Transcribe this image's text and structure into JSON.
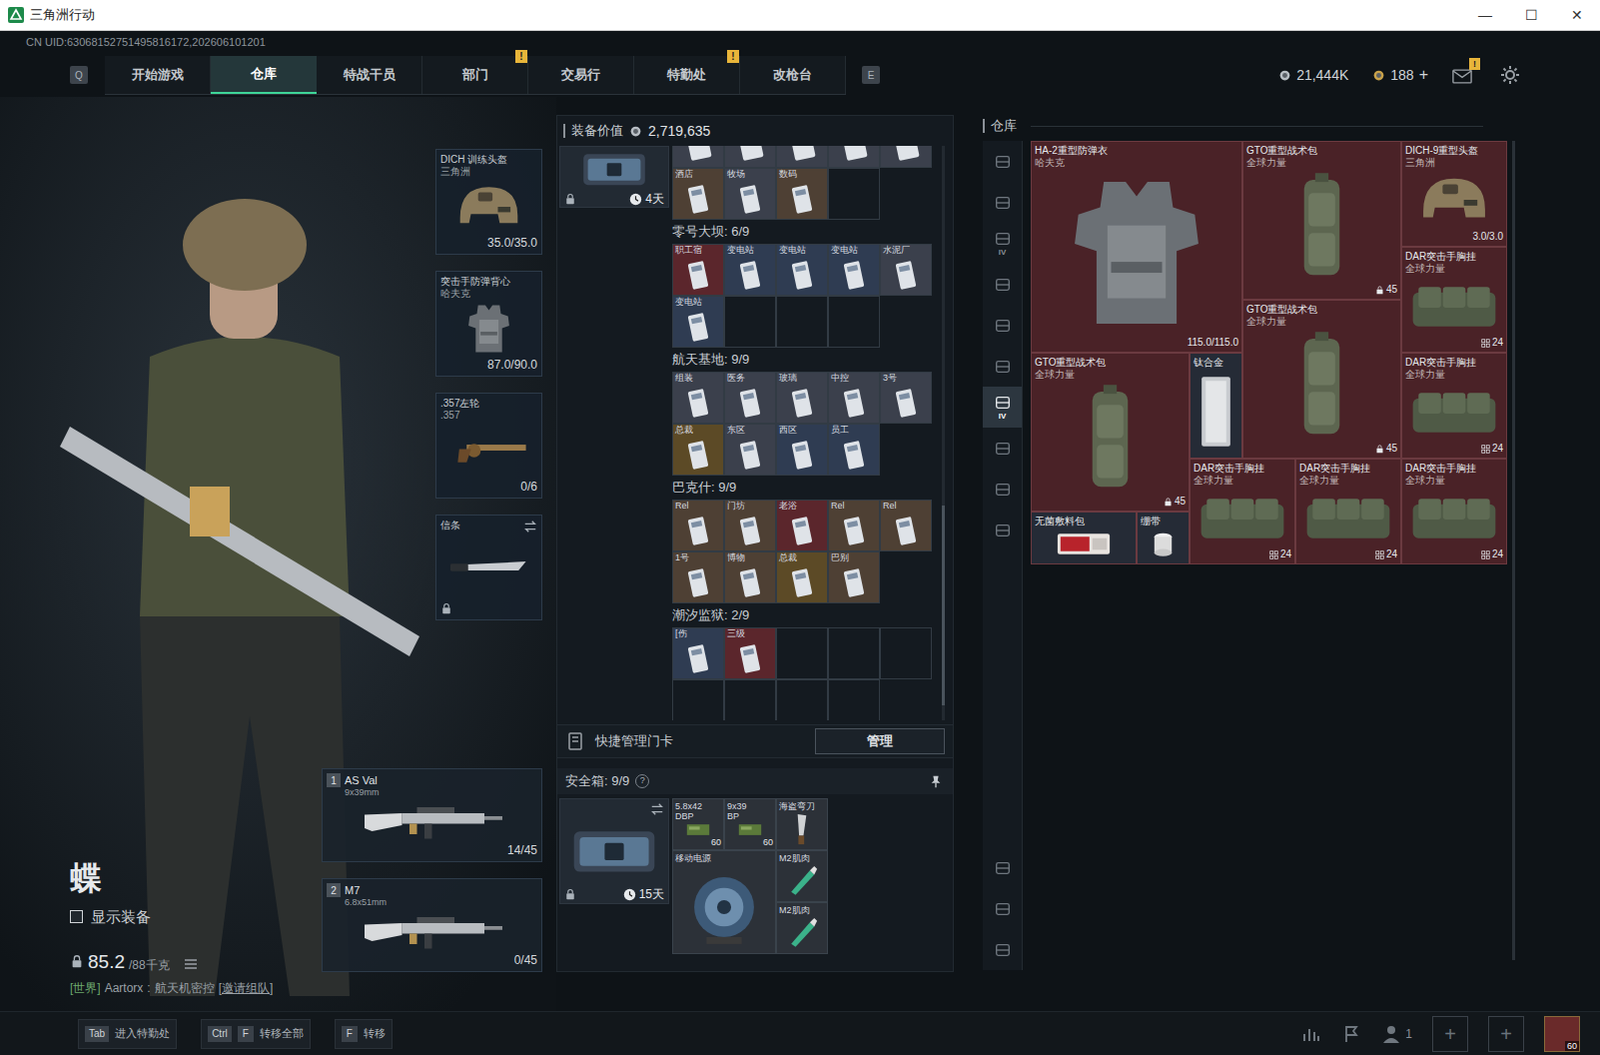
{
  "window": {
    "title": "三角洲行动",
    "controls": [
      "—",
      "☐",
      "✕"
    ]
  },
  "uid": "CN UID:63068152751495816172,202606101201",
  "nav": {
    "left_key": "Q",
    "right_key": "E",
    "tabs": [
      {
        "label": "开始游戏",
        "selected": false,
        "badge": ""
      },
      {
        "label": "仓库",
        "selected": true,
        "badge": ""
      },
      {
        "label": "特战干员",
        "selected": false,
        "badge": ""
      },
      {
        "label": "部门",
        "selected": false,
        "badge": "!"
      },
      {
        "label": "交易行",
        "selected": false,
        "badge": ""
      },
      {
        "label": "特勤处",
        "selected": false,
        "badge": "!"
      },
      {
        "label": "改枪台",
        "selected": false,
        "badge": ""
      }
    ]
  },
  "currency": {
    "coins": "21,444K",
    "tokens": "188",
    "add": "+",
    "mail_badge": "!"
  },
  "operator": {
    "name": "蝶",
    "show_gear": {
      "label": "显示装备",
      "checked": false
    },
    "weight": "85.2",
    "weight_max": "/88千克",
    "chat": {
      "channel": "[世界]",
      "user": "Aartorx",
      "separator": ":",
      "message": "航天机密控",
      "link": "[邀请组队]"
    }
  },
  "gear": [
    {
      "kind": "helmet",
      "name": "DICH 训练头盔",
      "sub": "三角洲",
      "value": "35.0/35.0",
      "locked": false
    },
    {
      "kind": "vest",
      "name": "突击手防弹背心",
      "sub": "哈夫克",
      "value": "87.0/90.0",
      "locked": false
    },
    {
      "kind": "revolver",
      "name": ".357左轮",
      "sub": ".357",
      "value": "0/6",
      "locked": false
    },
    {
      "kind": "knife",
      "name": "信条",
      "sub": "",
      "value": "",
      "locked": true
    }
  ],
  "weapons": [
    {
      "slot": "1",
      "name": "AS Val",
      "ammo": "9x39mm",
      "count": "14/45"
    },
    {
      "slot": "2",
      "name": "M7",
      "ammo": "6.8x51mm",
      "count": "0/45"
    }
  ],
  "loadout": {
    "label": "装备价值",
    "value": "2,719,635",
    "case_time": "4天",
    "case_locked": true
  },
  "keycards": [
    {
      "title": "",
      "slots": 9,
      "cards": [
        {
          "label": "",
          "color": "#3b404c"
        },
        {
          "label": "",
          "color": "#3b404c"
        },
        {
          "label": "",
          "color": "#3b404c"
        },
        {
          "label": "",
          "color": "#3b404c"
        },
        {
          "label": "",
          "color": "#3b404c"
        },
        {
          "label": "酒店",
          "color": "#4e4034"
        },
        {
          "label": "牧场",
          "color": "#3b404c"
        },
        {
          "label": "数码",
          "color": "#4e4034"
        }
      ]
    },
    {
      "title": "零号大坝: 6/9",
      "slots": 9,
      "cards": [
        {
          "label": "职工宿",
          "color": "#5b262c"
        },
        {
          "label": "变电站",
          "color": "#2f3c52"
        },
        {
          "label": "变电站",
          "color": "#2f3c52"
        },
        {
          "label": "变电站",
          "color": "#2f3c52"
        },
        {
          "label": "水泥厂",
          "color": "#3b404c"
        },
        {
          "label": "变电站",
          "color": "#2f3c52"
        }
      ]
    },
    {
      "title": "航天基地: 9/9",
      "slots": 9,
      "cards": [
        {
          "label": "组装",
          "color": "#3b404c"
        },
        {
          "label": "医务",
          "color": "#3b404c"
        },
        {
          "label": "玻璃",
          "color": "#3b404c"
        },
        {
          "label": "中控",
          "color": "#3b404c"
        },
        {
          "label": "3号",
          "color": "#3b404c"
        },
        {
          "label": "总裁",
          "color": "#5c4a26"
        },
        {
          "label": "东区",
          "color": "#3b404c"
        },
        {
          "label": "西区",
          "color": "#2f3c52"
        },
        {
          "label": "员工",
          "color": "#2f3c52"
        }
      ]
    },
    {
      "title": "巴克什: 9/9",
      "slots": 9,
      "cards": [
        {
          "label": "Rel",
          "color": "#4e4034"
        },
        {
          "label": "门坊",
          "color": "#4e4034"
        },
        {
          "label": "老浴",
          "color": "#5b262c"
        },
        {
          "label": "Rel",
          "color": "#4e4034"
        },
        {
          "label": "Rel",
          "color": "#4e4034"
        },
        {
          "label": "1号",
          "color": "#4e4034"
        },
        {
          "label": "博物",
          "color": "#4e4034"
        },
        {
          "label": "总裁",
          "color": "#5c4a26"
        },
        {
          "label": "巴别",
          "color": "#4e4034"
        }
      ]
    },
    {
      "title": "潮汐监狱: 2/9",
      "slots": 9,
      "cards": [
        {
          "label": "[伤",
          "color": "#2f3c52"
        },
        {
          "label": "三级",
          "color": "#5b262c"
        }
      ]
    }
  ],
  "quick_manage": {
    "label": "快捷管理门卡",
    "button": "管理"
  },
  "safe_box": {
    "label": "安全箱: 9/9",
    "help": "?",
    "time": "15天",
    "locked": true,
    "items": [
      {
        "kind": "ammo",
        "label": "5.8x42",
        "sub": "DBP",
        "count": "60",
        "color": "#2c3138"
      },
      {
        "kind": "ammo",
        "label": "9x39",
        "sub": "BP",
        "count": "60",
        "color": "#2c3138"
      },
      {
        "kind": "blade",
        "label": "海盗弯刀",
        "sub": "",
        "count": "",
        "color": "#2c3138"
      },
      {
        "kind": "powerbank",
        "label": "移动电源",
        "sub": "",
        "count": "",
        "color": "#2c3138"
      },
      {
        "kind": "injector",
        "label": "M2肌肉",
        "sub": "",
        "count": "",
        "color": "#2c3138"
      },
      {
        "kind": "injector",
        "label": "M2肌肉",
        "sub": "",
        "count": "",
        "color": "#2c3138"
      }
    ]
  },
  "stash": {
    "title": "仓库",
    "sidebar": [
      {
        "label": "",
        "selected": false
      },
      {
        "label": "",
        "selected": false
      },
      {
        "label": "IV",
        "selected": false
      },
      {
        "label": "",
        "selected": false
      },
      {
        "label": "",
        "selected": false
      },
      {
        "label": "",
        "selected": false
      },
      {
        "label": "IV",
        "selected": true
      },
      {
        "label": "",
        "selected": false
      },
      {
        "label": "",
        "selected": false
      },
      {
        "label": "",
        "selected": false
      },
      {
        "label": "",
        "selected": false
      },
      {
        "label": "",
        "selected": false
      },
      {
        "label": "",
        "selected": false
      }
    ],
    "items": [
      {
        "kind": "armor",
        "name": "HA-2重型防弹衣",
        "brand": "哈夫克",
        "value": "115.0/115.0",
        "color": "#4a2227"
      },
      {
        "kind": "backpack",
        "name": "GTO重型战术包",
        "brand": "全球力量",
        "value": "45",
        "color": "#4a2227"
      },
      {
        "kind": "helmet",
        "name": "DICH-9重型头盔",
        "brand": "三角洲",
        "value": "3.0/3.0",
        "color": "#4a2227"
      },
      {
        "kind": "rig",
        "name": "DAR突击手胸挂",
        "brand": "全球力量",
        "value": "24",
        "color": "#4a2227"
      },
      {
        "kind": "backpack",
        "name": "GTO重型战术包",
        "brand": "全球力量",
        "value": "45",
        "color": "#4a2227"
      },
      {
        "kind": "rig",
        "name": "DAR突击手胸挂",
        "brand": "全球力量",
        "value": "24",
        "color": "#4a2227"
      },
      {
        "kind": "backpack",
        "name": "GTO重型战术包",
        "brand": "全球力量",
        "value": "45",
        "color": "#4a2227"
      },
      {
        "kind": "metal",
        "name": "钛合金",
        "brand": "",
        "value": "",
        "color": "#252b36"
      },
      {
        "kind": "rig",
        "name": "DAR突击手胸挂",
        "brand": "全球力量",
        "value": "24",
        "color": "#4a2227"
      },
      {
        "kind": "rig",
        "name": "DAR突击手胸挂",
        "brand": "全球力量",
        "value": "24",
        "color": "#4a2227"
      },
      {
        "kind": "rig",
        "name": "DAR突击手胸挂",
        "brand": "全球力量",
        "value": "24",
        "color": "#4a2227"
      },
      {
        "kind": "medkit",
        "name": "无菌敷料包",
        "brand": "",
        "value": "",
        "color": "#252b36"
      },
      {
        "kind": "roll",
        "name": "绷带",
        "brand": "",
        "value": "",
        "color": "#252b36"
      }
    ]
  },
  "bottom_bar": {
    "hints": [
      {
        "keys": [
          "Tab"
        ],
        "label": "进入特勤处"
      },
      {
        "keys": [
          "Ctrl",
          "F"
        ],
        "label": "转移全部"
      },
      {
        "keys": [
          "F"
        ],
        "label": "转移"
      }
    ],
    "party": "1",
    "slots": [
      "+",
      "+"
    ],
    "level": "60"
  }
}
